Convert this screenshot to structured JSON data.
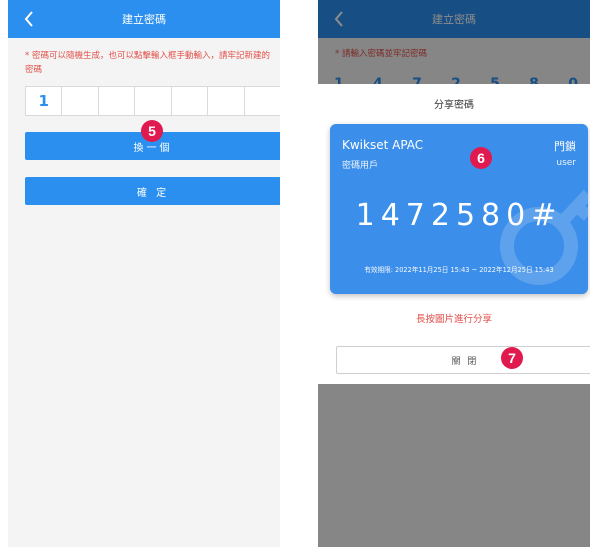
{
  "left": {
    "nav_title": "建立密碼",
    "hint": "* 密碼可以隨機生成，也可以點擊輸入框手動輸入，請牢記新建的密碼",
    "code_digits": [
      "1",
      "",
      "",
      "",
      "",
      "",
      ""
    ],
    "regenerate_label": "換一個",
    "confirm_label": "確 定",
    "badge": "5"
  },
  "right": {
    "nav_title": "建立密碼",
    "bg_hint": "* 請輸入密碼並牢記密碼",
    "bg_digits": [
      "1",
      "4",
      "7",
      "2",
      "5",
      "8",
      "0"
    ],
    "dialog_title": "分享密碼",
    "card": {
      "brand": "Kwikset APAC",
      "lock_label": "門鎖",
      "role": "密碼用戶",
      "user": "user",
      "code": "1472580#",
      "validity": "有效期限: 2022年11月25日 15:43 ~ 2022年12月25日 15:43"
    },
    "share_hint": "長按圖片進行分享",
    "close_label": "關 閉",
    "badge_card": "6",
    "badge_close": "7"
  },
  "colors": {
    "primary": "#2b8ff0",
    "accent_red": "#e2504a",
    "badge": "#e01a4f",
    "card": "#3b8ee9"
  },
  "icons": {
    "back": "chevron-left-icon",
    "watermark": "key-icon"
  }
}
